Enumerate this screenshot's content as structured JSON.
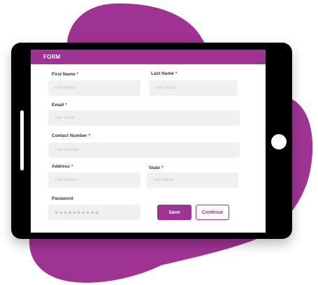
{
  "colors": {
    "accent": "#9e3393",
    "blob": "#9e3393",
    "device": "#000000"
  },
  "form": {
    "title": "FORM",
    "first_name": {
      "label": "First Name",
      "required": "*",
      "placeholder": "Your Name"
    },
    "last_name": {
      "label": "Last Name",
      "required": "*",
      "placeholder": "Your Name"
    },
    "email": {
      "label": "Email",
      "required": "*",
      "placeholder": "Your Email"
    },
    "contact_number": {
      "label": "Contact Number",
      "required": "*",
      "placeholder": "Your Number"
    },
    "address": {
      "label": "Address",
      "required": "*",
      "placeholder": "Your Name"
    },
    "state": {
      "label": "State",
      "required": "*",
      "placeholder": "Your Name"
    },
    "password": {
      "label": "Password",
      "placeholder": "●●●●●●●●●●"
    },
    "save_label": "Save",
    "continue_label": "Continue"
  }
}
